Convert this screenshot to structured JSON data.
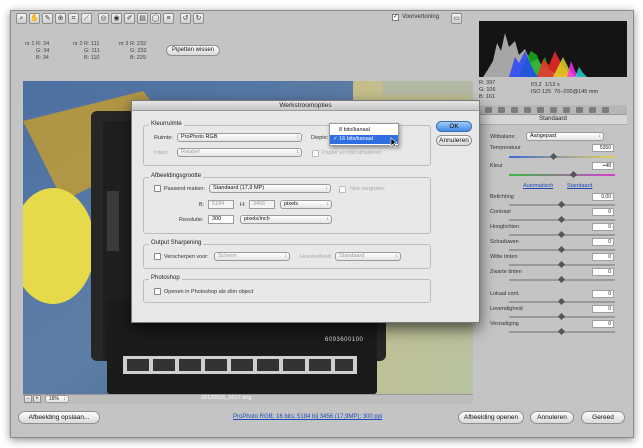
{
  "toolbar": {
    "tools": [
      "zoom-icon",
      "hand-icon",
      "eyedropper-icon",
      "target-icon",
      "crop-icon",
      "straighten-icon",
      "spot-icon",
      "redeye-icon",
      "brush-icon",
      "gradient-icon",
      "radial-icon",
      "list-icon",
      "rotate-ccw-icon",
      "rotate-cw-icon"
    ],
    "preview_label": "Voorvertoning",
    "preview_checked": true
  },
  "samplers": [
    {
      "r": "nr 1 R: 34",
      "g": "G: 34",
      "b": "B: 34"
    },
    {
      "r": "nr 2 R: 111",
      "g": "G: 111",
      "b": "B: 110"
    },
    {
      "r": "nr 3 R: 232",
      "g": "G: 232",
      "b": "B: 229"
    }
  ],
  "clear_samplers": "Pipetten wissen",
  "rgb": {
    "r": "R: 397",
    "g": "G: 106",
    "b": "B: 161"
  },
  "exif": {
    "aperture": "f/3,2",
    "shutter": "1/13 s",
    "iso": "ISO 125",
    "lens": "70–200@145 mm"
  },
  "panel": {
    "title": "Standaard",
    "wb_label": "Witbalans:",
    "wb_value": "Aangepast",
    "temp_label": "Temperatuur",
    "temp_value": "5350",
    "tint_label": "Kleur",
    "tint_value": "+48",
    "auto": "Automatisch",
    "default": "Standaard",
    "sliders": [
      {
        "label": "Belichting",
        "value": "0,00"
      },
      {
        "label": "Contrast",
        "value": "0"
      },
      {
        "label": "Hooglichten",
        "value": "0"
      },
      {
        "label": "Schaduwen",
        "value": "0"
      },
      {
        "label": "Witte tinten",
        "value": "0"
      },
      {
        "label": "Zwarte tinten",
        "value": "0"
      },
      {
        "label": "Lokaal cont.",
        "value": "0"
      },
      {
        "label": "Levendigheid",
        "value": "0"
      },
      {
        "label": "Verzadiging",
        "value": "0"
      }
    ]
  },
  "zoom": {
    "value": "18%"
  },
  "filename": "20120505_0017.dng",
  "bottom": {
    "save": "Afbeelding opslaan...",
    "info": "ProPhoto RGB; 16 bits; 5184 bij 3456 (17,9MP); 300 ppi",
    "open": "Afbeelding openen",
    "cancel": "Annuleren",
    "done": "Gereed"
  },
  "image": {
    "labels": [
      "6093600100"
    ]
  },
  "dialog": {
    "title": "Werkstroomopties",
    "ok": "OK",
    "cancel": "Annuleren",
    "colorspace": {
      "title": "Kleurruimte",
      "space_label": "Ruimte:",
      "space_value": "ProPhoto RGB",
      "depth_label": "Diepte:",
      "intent_label": "Intent:",
      "intent_value": "Relatief",
      "simulate_label": "Papier en inkt simuleren"
    },
    "depth_menu": [
      "8 bits/kanaal",
      "16 bits/kanaal"
    ],
    "size": {
      "title": "Afbeeldingsgrootte",
      "resize_label": "Passend maken:",
      "resize_value": "Standaard (17,9 MP)",
      "enlarge_label": "Niet vergroten",
      "w_label": "B:",
      "w_value": "5184",
      "h_label": "H:",
      "h_value": "3456",
      "unit": "pixels",
      "res_label": "Resolutie:",
      "res_value": "300",
      "res_unit": "pixels/inch"
    },
    "sharpen": {
      "title": "Output Sharpening",
      "label": "Verscherpen voor:",
      "value": "Scherm",
      "amount_label": "Hoeveelheid:",
      "amount_value": "Standaard"
    },
    "photoshop": {
      "title": "Photoshop",
      "label": "Openen in Photoshop als slim object"
    }
  }
}
